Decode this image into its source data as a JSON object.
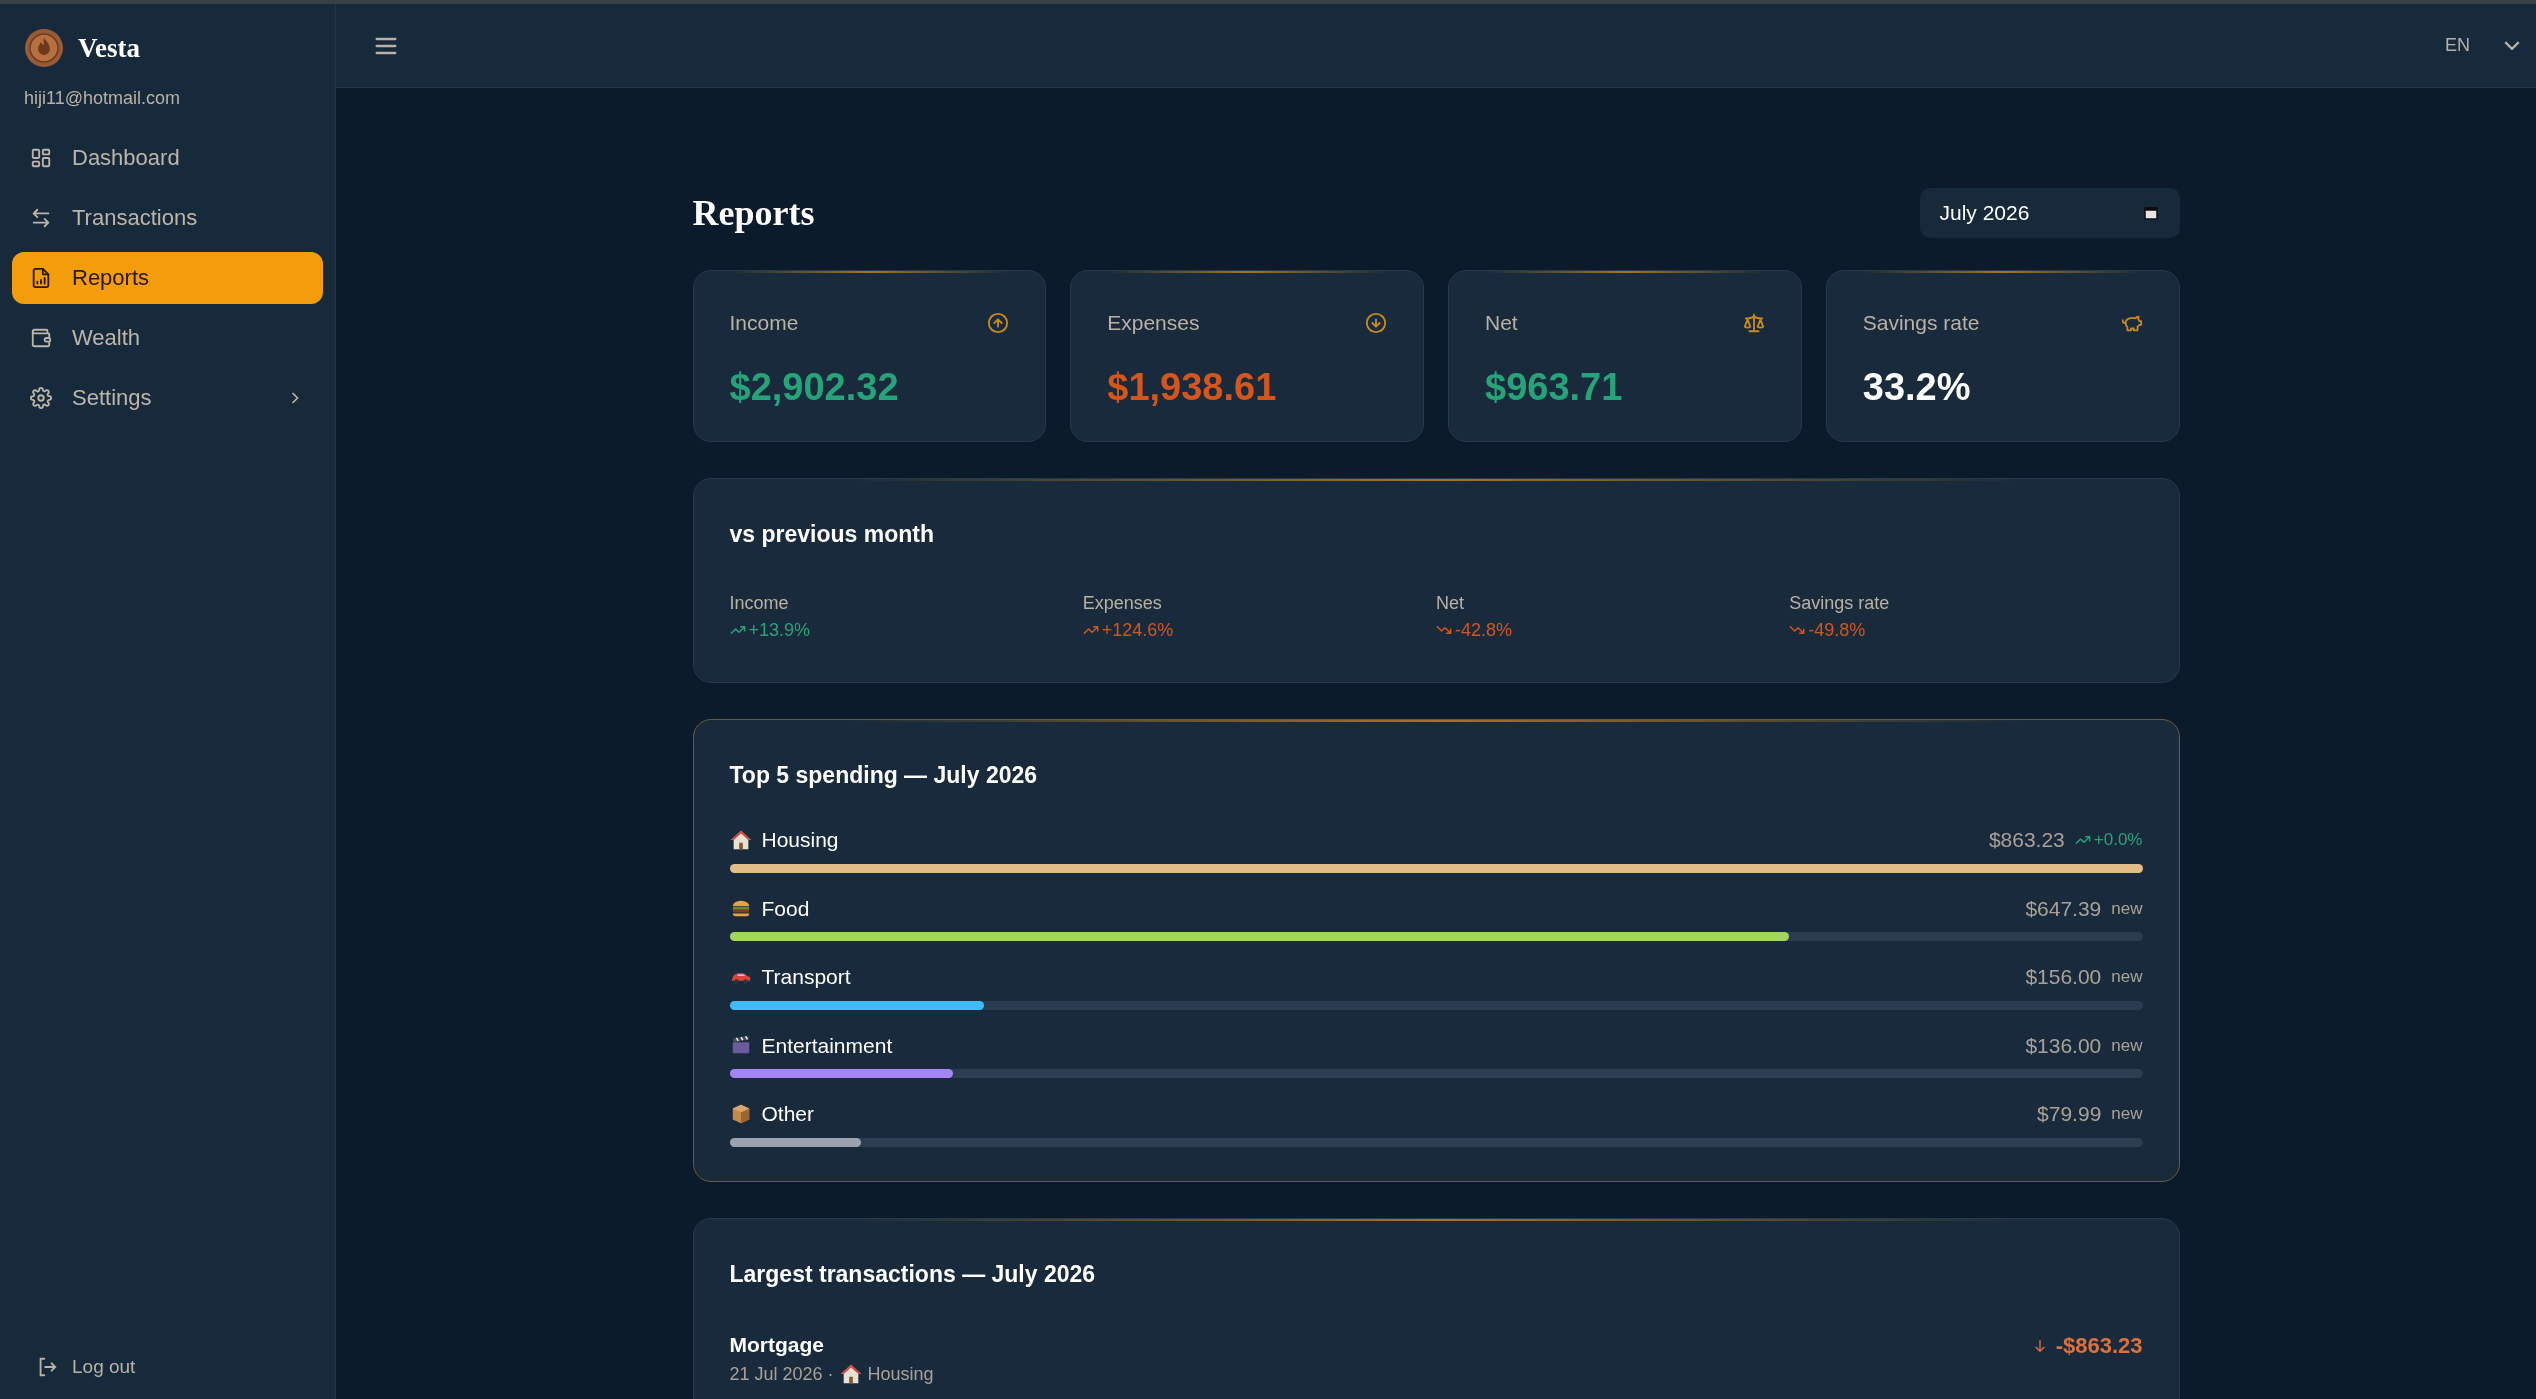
{
  "sidebar": {
    "brand": "Vesta",
    "email": "hiji11@hotmail.com",
    "items": [
      {
        "label": "Dashboard",
        "selected": false,
        "expandable": false
      },
      {
        "label": "Transactions",
        "selected": false,
        "expandable": false
      },
      {
        "label": "Reports",
        "selected": true,
        "expandable": false
      },
      {
        "label": "Wealth",
        "selected": false,
        "expandable": false
      },
      {
        "label": "Settings",
        "selected": false,
        "expandable": true
      }
    ],
    "logout": "Log out"
  },
  "header": {
    "language": "EN"
  },
  "page": {
    "title": "Reports",
    "month": "July 2026"
  },
  "summary_cards": [
    {
      "label": "Income",
      "value": "$2,902.32",
      "kind": "positive"
    },
    {
      "label": "Expenses",
      "value": "$1,938.61",
      "kind": "negative"
    },
    {
      "label": "Net",
      "value": "$963.71",
      "kind": "positive"
    },
    {
      "label": "Savings rate",
      "value": "33.2%",
      "kind": "neutral"
    }
  ],
  "comparison": {
    "title": "vs previous month",
    "items": [
      {
        "label": "Income",
        "delta": "+13.9%",
        "kind": "gain"
      },
      {
        "label": "Expenses",
        "delta": "+124.6%",
        "kind": "rise"
      },
      {
        "label": "Net",
        "delta": "-42.8%",
        "kind": "drop"
      },
      {
        "label": "Savings rate",
        "delta": "-49.8%",
        "kind": "drop"
      }
    ]
  },
  "top_spending": {
    "title": "Top 5 spending — July 2026",
    "items": [
      {
        "label": "Housing",
        "amount": "$863.23",
        "change": "+0.0%",
        "kind": "trend",
        "level": 1.0,
        "color": "#e1bd88"
      },
      {
        "label": "Food",
        "amount": "$647.39",
        "change": "new",
        "kind": "new",
        "level": 0.75,
        "color": "#a3d65c"
      },
      {
        "label": "Transport",
        "amount": "$156.00",
        "change": "new",
        "kind": "new",
        "level": 0.18,
        "color": "#3fbcf6"
      },
      {
        "label": "Entertainment",
        "amount": "$136.00",
        "change": "new",
        "kind": "new",
        "level": 0.158,
        "color": "#a585f5"
      },
      {
        "label": "Other",
        "amount": "$79.99",
        "change": "new",
        "kind": "new",
        "level": 0.093,
        "color": "#9ca3af"
      }
    ]
  },
  "largest_transactions": {
    "title": "Largest transactions — July 2026",
    "rows": [
      {
        "name": "Mortgage",
        "date": "21 Jul 2026 ·",
        "category": "Housing",
        "amount": "-$863.23",
        "kind": "expense"
      }
    ]
  }
}
